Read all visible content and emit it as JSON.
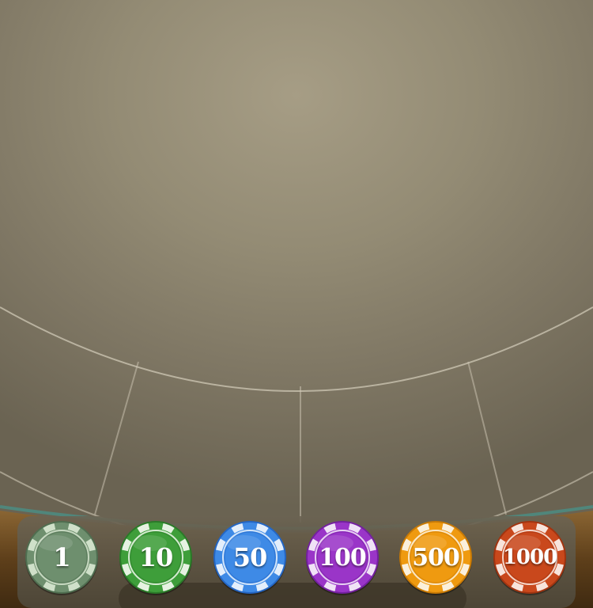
{
  "chips": [
    {
      "value": "1",
      "color": "#6e8f6e",
      "dark": "#4f6e50",
      "stripe": "#cfe0c9"
    },
    {
      "value": "10",
      "color": "#3e9e3a",
      "dark": "#2a7a28",
      "stripe": "#e6f2e2"
    },
    {
      "value": "50",
      "color": "#3e8ae6",
      "dark": "#2466c4",
      "stripe": "#e3eefb"
    },
    {
      "value": "100",
      "color": "#9a35c8",
      "dark": "#7420a0",
      "stripe": "#f0e2f6"
    },
    {
      "value": "500",
      "color": "#ef9a10",
      "dark": "#c97a05",
      "stripe": "#fbf0dc"
    },
    {
      "value": "1000",
      "color": "#c9481c",
      "dark": "#a23410",
      "stripe": "#f7e4dc"
    }
  ],
  "colors": {
    "felt": "#938b74",
    "line": "#cfc8b5",
    "wood": "#6b4a22"
  }
}
